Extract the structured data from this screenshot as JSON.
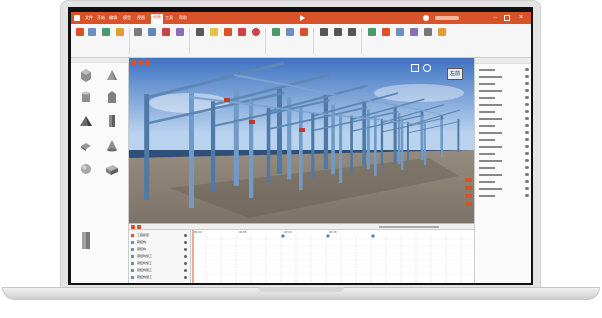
{
  "app": {
    "title_bar_text": "",
    "menu": [
      "文件",
      "开始",
      "编辑",
      "模型",
      "视图",
      "动画",
      "工具",
      "帮助"
    ],
    "active_menu_index": 5
  },
  "ribbon": {
    "groups": [
      "",
      "",
      "",
      "",
      "",
      "",
      ""
    ]
  },
  "viewport": {
    "view_label": "左前"
  },
  "timeline": {
    "header": "",
    "rows": [
      "工程模型",
      "钢结构",
      "钢结构",
      "钢结构施工",
      "钢结构施工",
      "钢结构施工",
      "钢结构施工"
    ],
    "ticks": [
      "00:00",
      "00:05",
      "00:10",
      "00:15"
    ]
  },
  "right_panel": {
    "rows": [
      "",
      "",
      "",
      "",
      "",
      "",
      "",
      "",
      "",
      "",
      "",
      "",
      "",
      "",
      "",
      "",
      "",
      "",
      ""
    ]
  },
  "colors": {
    "accent": "#d9532a",
    "steel": "#5d88b5",
    "sky_top": "#3f73c2",
    "sky_bottom": "#b9d2ee",
    "ground": "#8a8074"
  }
}
